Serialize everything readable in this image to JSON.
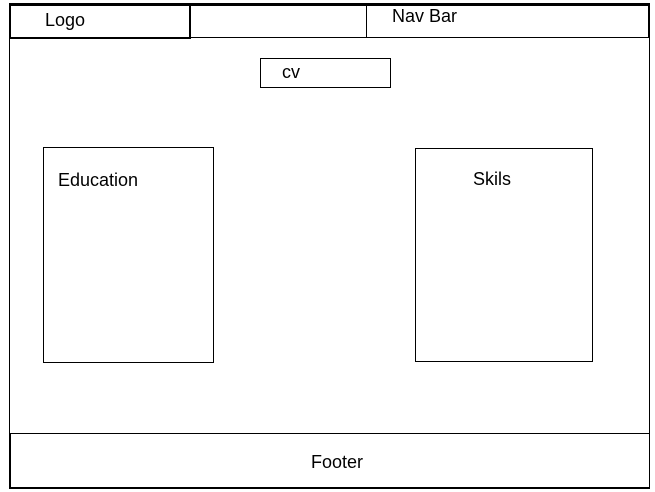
{
  "header": {
    "logo_label": "Logo",
    "navbar_label": "Nav Bar"
  },
  "main": {
    "cv_label": "cv",
    "education_label": "Education",
    "skills_label": "Skils"
  },
  "footer": {
    "label": "Footer"
  }
}
